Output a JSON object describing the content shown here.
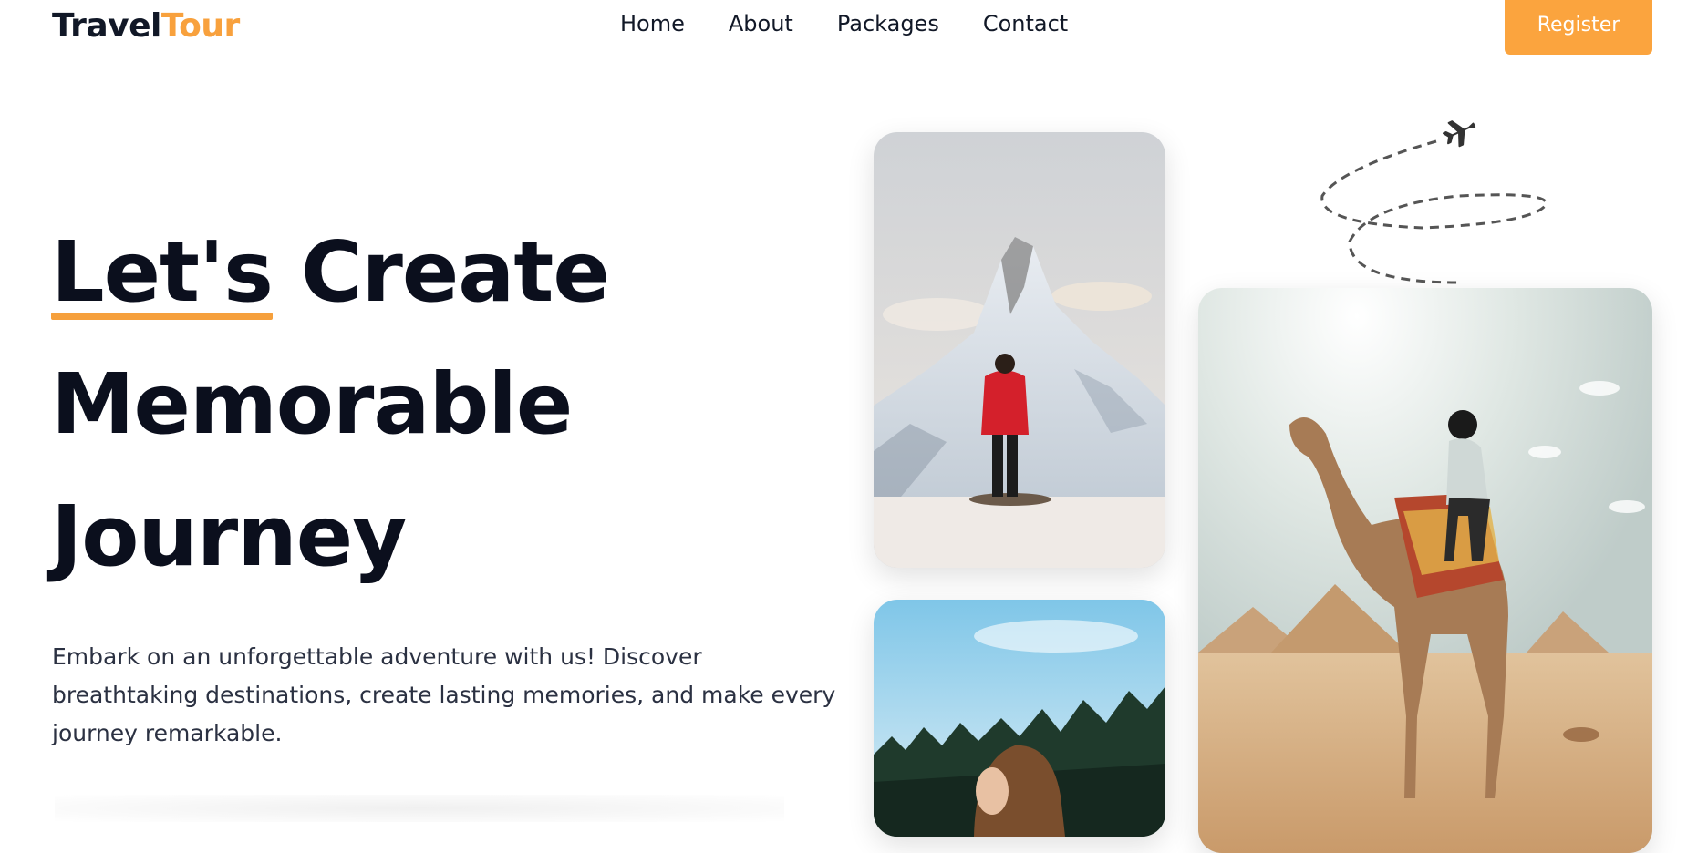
{
  "brand": {
    "name_part1": "Travel",
    "name_part2": "Tour",
    "accent_color": "#fba43e"
  },
  "nav": {
    "items": [
      {
        "label": "Home"
      },
      {
        "label": "About"
      },
      {
        "label": "Packages"
      },
      {
        "label": "Contact"
      }
    ]
  },
  "header": {
    "register_label": "Register"
  },
  "hero": {
    "title_word1": "Let's",
    "title_word2": "Create",
    "title_line2": "Memorable",
    "title_line3": "Journey",
    "description": "Embark on an unforgettable adventure with us! Discover breathtaking destinations, create lasting memories, and make every journey remarkable."
  },
  "images": [
    {
      "icon": "mountain-hiker-image"
    },
    {
      "icon": "forest-woman-image"
    },
    {
      "icon": "camel-pyramids-image"
    }
  ],
  "decor": {
    "icon": "airplane-icon"
  }
}
